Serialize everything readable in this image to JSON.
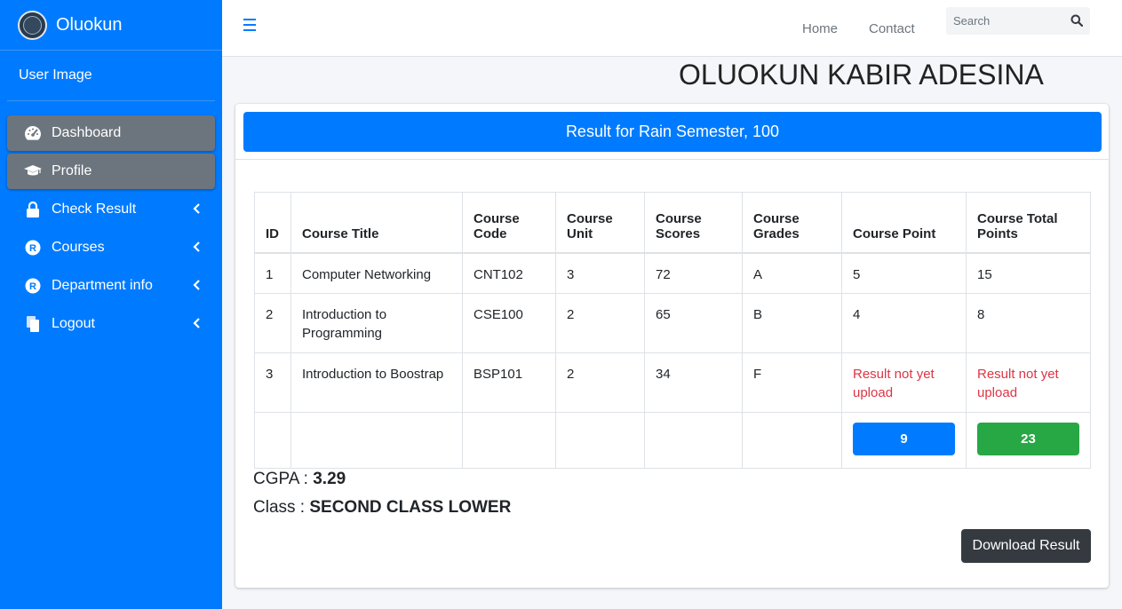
{
  "brand": {
    "name": "Oluokun",
    "logo_icon": "school-logo-icon"
  },
  "user_panel": {
    "label": "User Image"
  },
  "sidebar": {
    "items": [
      {
        "label": "Dashboard",
        "icon": "tachometer-icon",
        "active": true
      },
      {
        "label": "Profile",
        "icon": "graduation-cap-icon",
        "active": true
      },
      {
        "label": "Check Result",
        "icon": "lock-icon"
      },
      {
        "label": "Courses",
        "icon": "registered-icon"
      },
      {
        "label": "Department info",
        "icon": "registered-icon"
      },
      {
        "label": "Logout",
        "icon": "copy-icon"
      }
    ]
  },
  "topnav": {
    "home": "Home",
    "contact": "Contact",
    "search_placeholder": "Search"
  },
  "page": {
    "student_name": "OLUOKUN KABIR ADESINA",
    "result_header": "Result for Rain Semester, 100"
  },
  "table": {
    "headers": [
      "ID",
      "Course Title",
      "Course Code",
      "Course Unit",
      "Course Scores",
      "Course Grades",
      "Course Point",
      "Course Total Points"
    ],
    "rows": [
      [
        "1",
        "Computer Networking",
        "CNT102",
        "3",
        "72",
        "A",
        "5",
        "15"
      ],
      [
        "2",
        "Introduction to Programming",
        "CSE100",
        "2",
        "65",
        "B",
        "4",
        "8"
      ],
      [
        "3",
        "Introduction to Boostrap",
        "BSP101",
        "2",
        "34",
        "F",
        "Result not yet upload",
        "Result not yet upload"
      ]
    ],
    "totals": {
      "units": "9",
      "points": "23"
    }
  },
  "summary": {
    "cgpa_label": "CGPA : ",
    "cgpa_value": "3.29",
    "class_label": "Class : ",
    "class_value": "SECOND CLASS LOWER"
  },
  "actions": {
    "download": "Download Result"
  },
  "colors": {
    "primary": "#007bff",
    "success": "#28a745",
    "danger": "#dc3545",
    "dark": "#343a40",
    "active_nav": "#6c757d"
  }
}
